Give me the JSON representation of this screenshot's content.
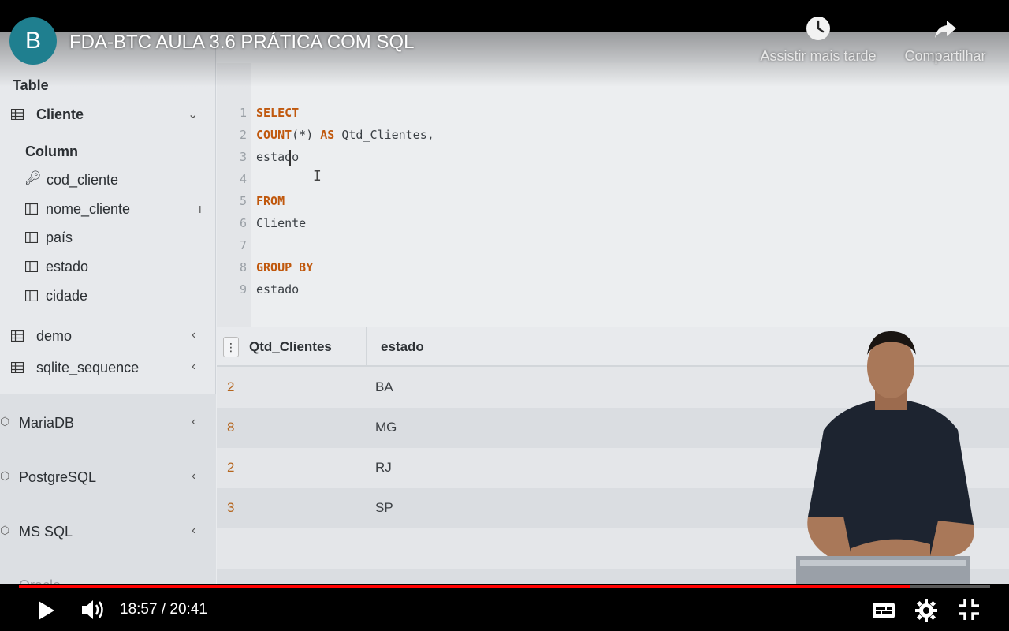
{
  "video": {
    "channel_initial": "B",
    "title": "FDA-BTC AULA 3.6 PRÁTICA COM SQL",
    "watch_later_label": "Assistir mais tarde",
    "share_label": "Compartilhar",
    "current_time": "18:57",
    "duration": "20:41",
    "time_display": "18:57 / 20:41",
    "progress_fraction": 0.917
  },
  "sidebar": {
    "table_heading": "Table",
    "active_table": "Cliente",
    "column_heading": "Column",
    "columns": [
      "cod_cliente",
      "nome_cliente",
      "país",
      "estado",
      "cidade"
    ],
    "other_tables": [
      "demo",
      "sqlite_sequence"
    ],
    "databases": [
      "MariaDB",
      "PostgreSQL",
      "MS SQL",
      "Oracle"
    ]
  },
  "editor": {
    "line_numbers": [
      "1",
      "2",
      "3",
      "4",
      "5",
      "6",
      "7",
      "8",
      "9"
    ],
    "lines": {
      "l1_kw": "SELECT",
      "l2_kw1": "COUNT",
      "l2_paren": "(*)",
      "l2_kw2": "AS",
      "l2_rest": "Qtd_Clientes,",
      "l3": "estado",
      "l5_kw": "FROM",
      "l6": "Cliente",
      "l8_kw": "GROUP BY",
      "l9": "estado"
    }
  },
  "results": {
    "columns": [
      "Qtd_Clientes",
      "estado"
    ],
    "rows": [
      {
        "qtd": "2",
        "estado": "BA"
      },
      {
        "qtd": "8",
        "estado": "MG"
      },
      {
        "qtd": "2",
        "estado": "RJ"
      },
      {
        "qtd": "3",
        "estado": "SP"
      }
    ]
  },
  "colors": {
    "progress": "#ff0000",
    "keyword": "#c0580d",
    "avatar": "#1f7f8f"
  }
}
